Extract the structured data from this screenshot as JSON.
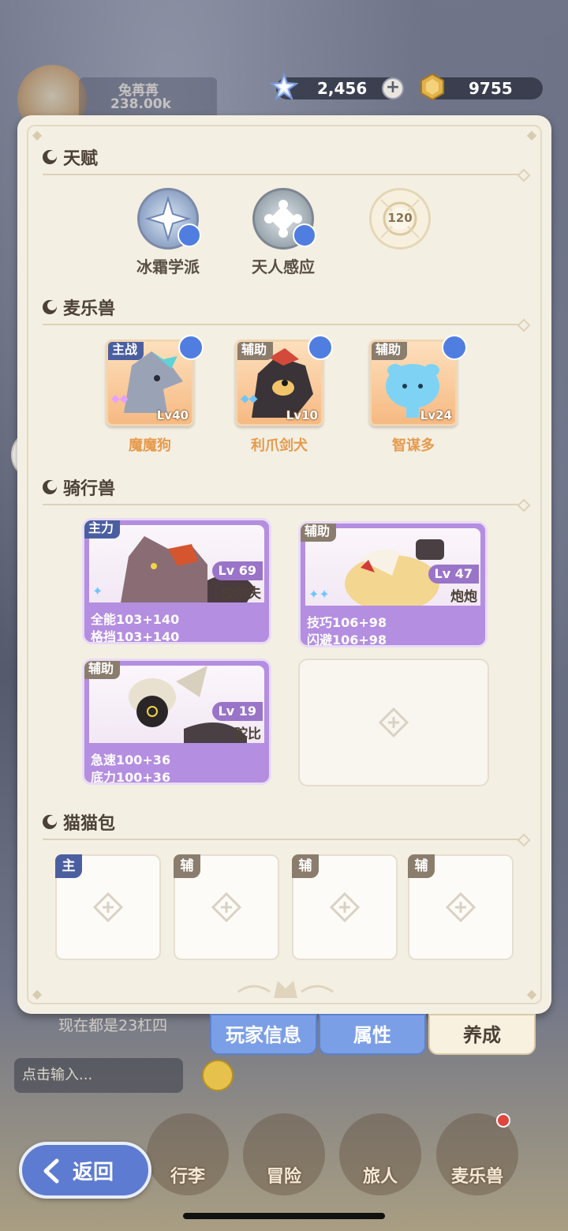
{
  "top": {
    "player_name": "兔苒苒",
    "player_power": "238.00k",
    "gems": "2,456",
    "coins": "9755",
    "plus": "+"
  },
  "talent": {
    "title": "天赋",
    "items": [
      {
        "label": "冰霜学派",
        "icon": "frost-school-icon"
      },
      {
        "label": "天人感应",
        "icon": "heaven-resonance-icon"
      },
      {
        "label": "",
        "icon": "locked-talent-icon",
        "level": "120"
      }
    ]
  },
  "pets": {
    "title": "麦乐兽",
    "items": [
      {
        "tag": "主战",
        "name": "魔魔狗",
        "lv": "Lv40"
      },
      {
        "tag": "辅助",
        "name": "利爪剑犬",
        "lv": "Lv10"
      },
      {
        "tag": "辅助",
        "name": "智谋多",
        "lv": "Lv24"
      }
    ]
  },
  "mounts": {
    "title": "骑行兽",
    "items": [
      {
        "tag": "主力",
        "name": "拉尔夫",
        "lv": "Lv 69",
        "stat1": "全能103+140",
        "stat2": "格挡103+140"
      },
      {
        "tag": "辅助",
        "name": "炮炮",
        "lv": "Lv 47",
        "stat1": "技巧106+98",
        "stat2": "闪避106+98"
      },
      {
        "tag": "辅助",
        "name": "驼比",
        "lv": "Lv 19",
        "stat1": "急速100+36",
        "stat2": "底力100+36"
      }
    ]
  },
  "catbag": {
    "title": "猫猫包",
    "slots": [
      "主",
      "辅",
      "辅",
      "辅"
    ]
  },
  "tabs": [
    "玩家信息",
    "属性",
    "养成"
  ],
  "chat": {
    "message": "现在都是23杠四",
    "input_placeholder": "点击输入..."
  },
  "nav": [
    "行李",
    "冒险",
    "旅人",
    "麦乐兽"
  ],
  "back_label": "返回",
  "colors": {
    "panel": "#f4efe3",
    "mount_card": "#b48ee0",
    "tab_blue": "#7b9fe6",
    "pet_name": "#e69a4c"
  }
}
